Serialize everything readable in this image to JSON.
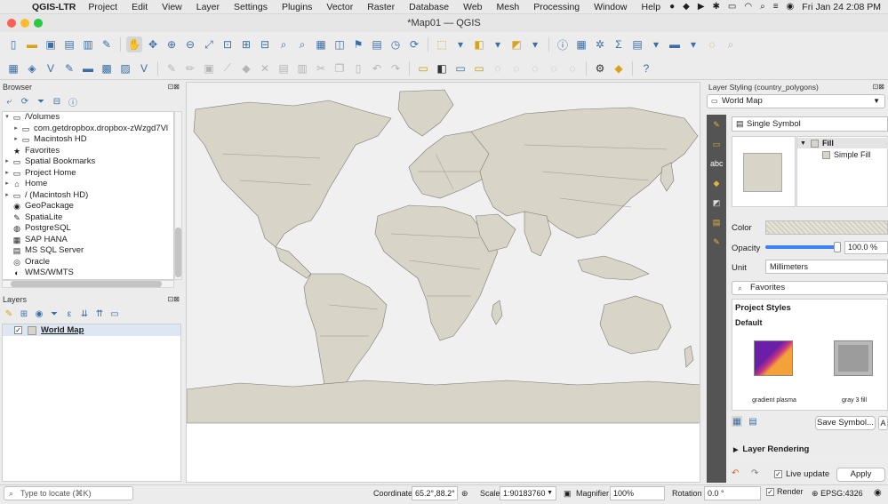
{
  "menubar": {
    "app_name": "QGIS-LTR",
    "items": [
      "Project",
      "Edit",
      "View",
      "Layer",
      "Settings",
      "Plugins",
      "Vector",
      "Raster",
      "Database",
      "Web",
      "Mesh",
      "Processing",
      "Window",
      "Help"
    ],
    "datetime": "Fri Jan 24  2:08 PM"
  },
  "window": {
    "title": "*Map01 — QGIS"
  },
  "browser": {
    "title": "Browser",
    "items": [
      {
        "label": "/Volumes",
        "level": 0,
        "arrow": "▾",
        "icon": "▭"
      },
      {
        "label": "com.getdropbox.dropbox-zWzgd7Vl",
        "level": 1,
        "arrow": "▸",
        "icon": "▭"
      },
      {
        "label": "Macintosh HD",
        "level": 1,
        "arrow": "▸",
        "icon": "▭"
      },
      {
        "label": "Favorites",
        "level": 0,
        "arrow": "",
        "icon": "★"
      },
      {
        "label": "Spatial Bookmarks",
        "level": 0,
        "arrow": "▸",
        "icon": "▭"
      },
      {
        "label": "Project Home",
        "level": 0,
        "arrow": "▸",
        "icon": "▭"
      },
      {
        "label": "Home",
        "level": 0,
        "arrow": "▸",
        "icon": "⌂"
      },
      {
        "label": "/ (Macintosh HD)",
        "level": 0,
        "arrow": "▸",
        "icon": "▭"
      },
      {
        "label": "GeoPackage",
        "level": 0,
        "arrow": "",
        "icon": "◉"
      },
      {
        "label": "SpatiaLite",
        "level": 0,
        "arrow": "",
        "icon": "✎"
      },
      {
        "label": "PostgreSQL",
        "level": 0,
        "arrow": "",
        "icon": "◍"
      },
      {
        "label": "SAP HANA",
        "level": 0,
        "arrow": "",
        "icon": "▦"
      },
      {
        "label": "MS SQL Server",
        "level": 0,
        "arrow": "",
        "icon": "▤"
      },
      {
        "label": "Oracle",
        "level": 0,
        "arrow": "",
        "icon": "◎"
      },
      {
        "label": "WMS/WMTS",
        "level": 0,
        "arrow": "",
        "icon": "◐"
      }
    ]
  },
  "layers_panel": {
    "title": "Layers",
    "layers": [
      {
        "name": "World Map",
        "checked": true
      }
    ]
  },
  "style_panel": {
    "title": "Layer Styling (country_polygons)",
    "layer_selected": "World Map",
    "renderer": "Single Symbol",
    "symbol_tree": {
      "root": "Fill",
      "child": "Simple Fill"
    },
    "color_label": "Color",
    "fill_color": "#d8d4c7",
    "opacity_label": "Opacity",
    "opacity_value": "100.0 %",
    "opacity_fraction": 1.0,
    "unit_label": "Unit",
    "unit_value": "Millimeters",
    "favorites_search": "Favorites",
    "project_styles": "Project Styles",
    "default_label": "Default",
    "styles": [
      {
        "name": "gradient  plasma",
        "icon": "gradient-swatch"
      },
      {
        "name": "gray 3 fill",
        "icon": "gray-swatch"
      }
    ],
    "save_symbol": "Save Symbol...",
    "advanced": "A",
    "layer_rendering": "Layer Rendering",
    "live_update": "Live update",
    "apply": "Apply"
  },
  "statusbar": {
    "locator_placeholder": "Type to locate (⌘K)",
    "coordinate_label": "Coordinate",
    "coordinate_value": "65.2°,88.2°",
    "scale_label": "Scale",
    "scale_value": "1:90183760",
    "magnifier_label": "Magnifier",
    "magnifier_value": "100%",
    "rotation_label": "Rotation",
    "rotation_value": "0.0 °",
    "render_label": "Render",
    "crs": "EPSG:4326"
  },
  "colors": {
    "land": "#d8d4c7",
    "ocean": "#f0f0f0",
    "accent": "#3b82f6"
  }
}
